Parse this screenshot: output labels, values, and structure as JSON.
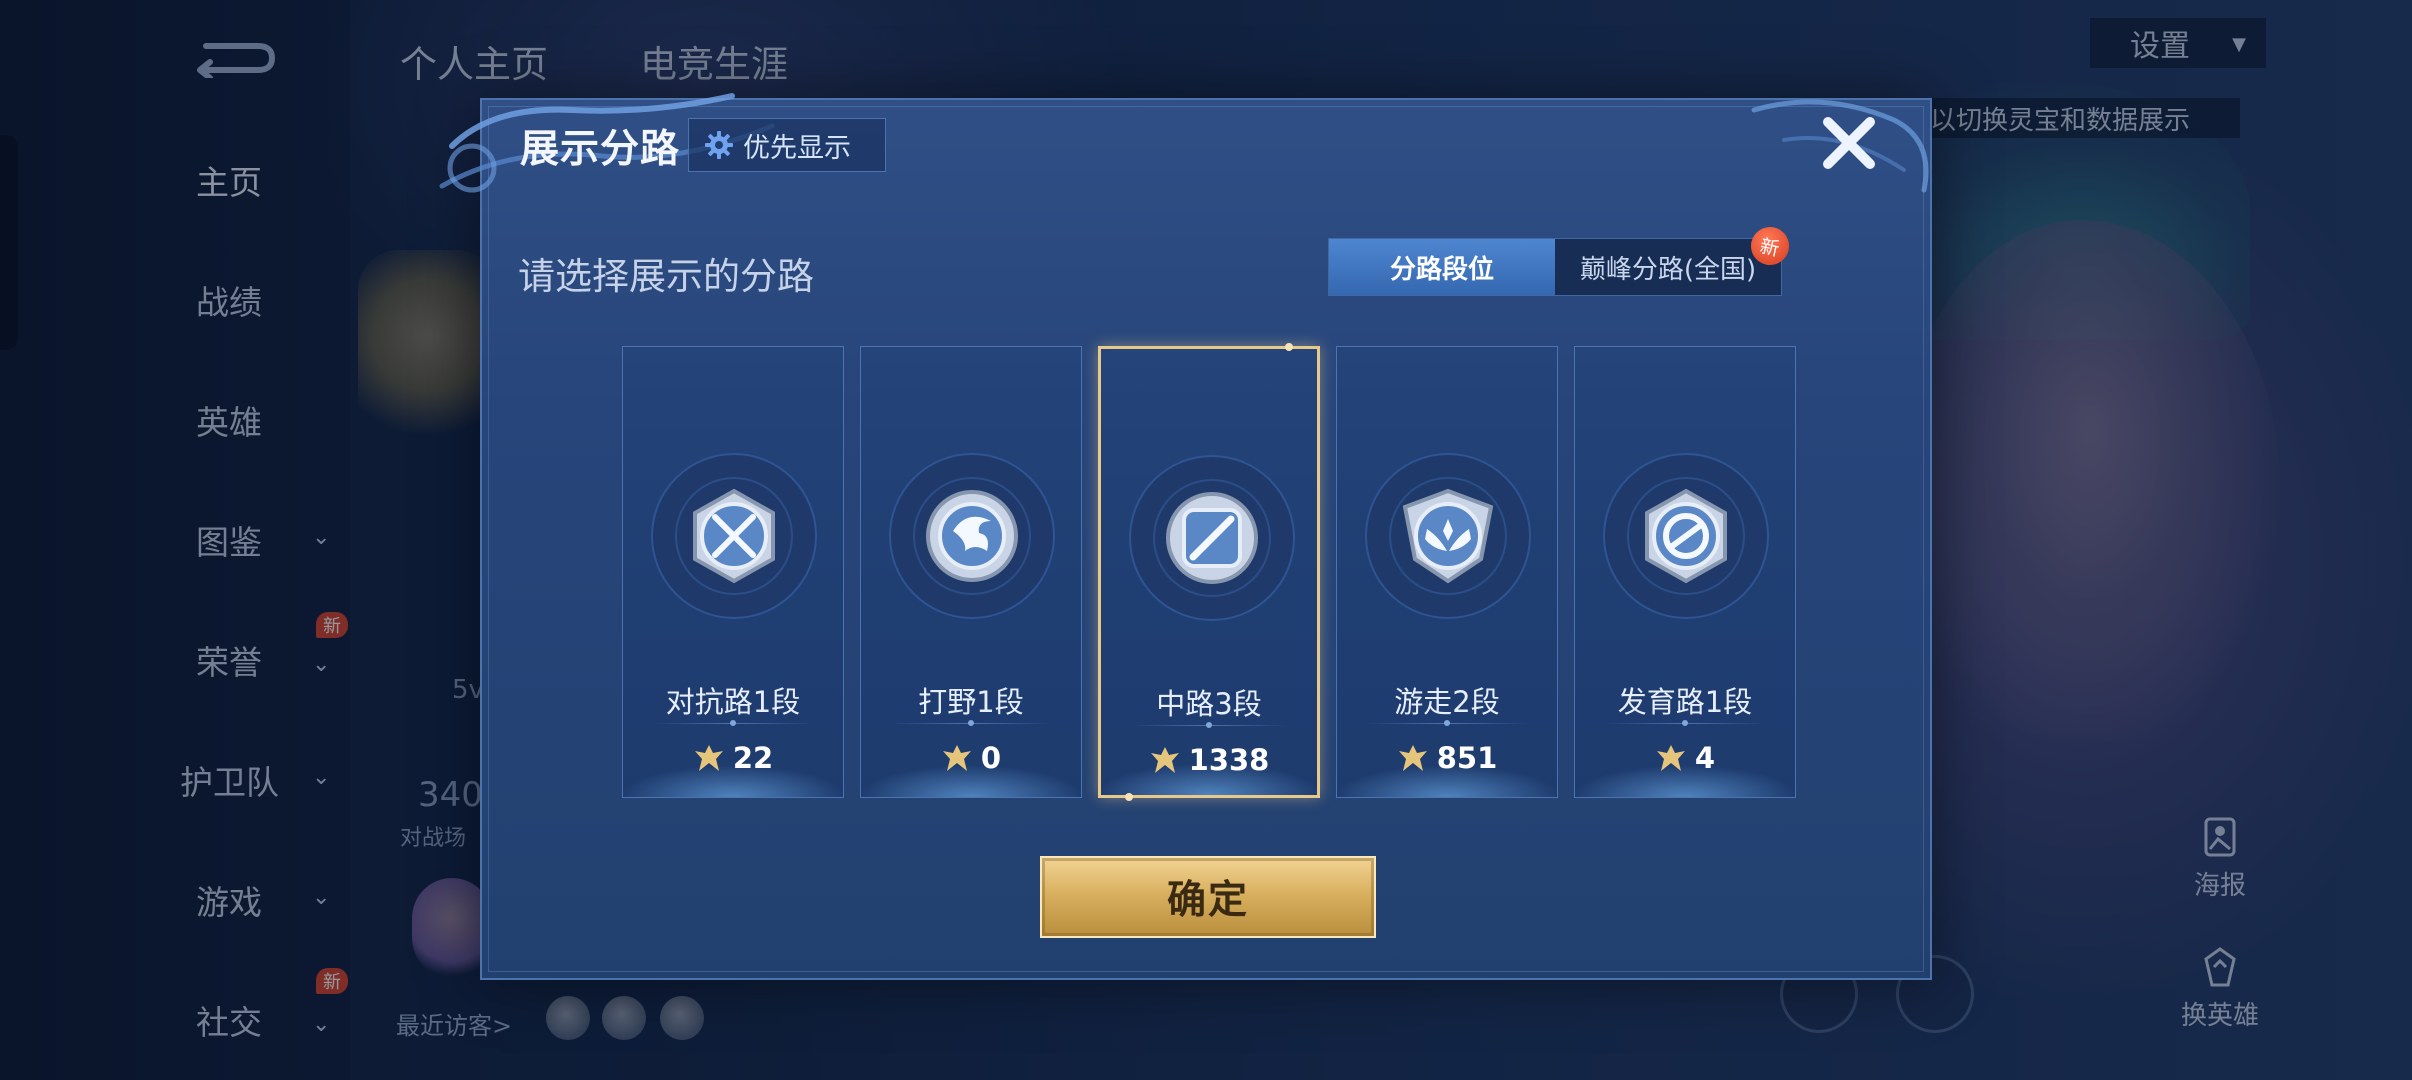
{
  "nav": {
    "items": [
      {
        "label": "主页",
        "active": true
      },
      {
        "label": "战绩"
      },
      {
        "label": "英雄"
      },
      {
        "label": "图鉴"
      },
      {
        "label": "荣誉"
      },
      {
        "label": "护卫队"
      },
      {
        "label": "游戏"
      },
      {
        "label": "社交"
      }
    ],
    "new_badge": "新"
  },
  "top_tabs": [
    "个人主页",
    "电竞生涯"
  ],
  "settings": {
    "label": "设置"
  },
  "hint": "以切换灵宝和数据展示",
  "profile": {
    "score_partial": "340",
    "score_sub_partial": "对战场",
    "mode_partial": "5v",
    "recent_visitors": "最近访客>"
  },
  "right_actions": [
    {
      "label": "海报",
      "icon": "poster-icon"
    },
    {
      "label": "换英雄",
      "icon": "switch-hero-icon"
    }
  ],
  "dialog": {
    "title": "展示分路",
    "priority_button": "优先显示",
    "subtitle": "请选择展示的分路",
    "toggle": {
      "options": [
        "分路段位",
        "巅峰分路(全国)"
      ],
      "active_index": 0,
      "new_badge": "新"
    },
    "lanes": [
      {
        "name": "对抗路1段",
        "score": "22",
        "icon": "clash-lane-icon",
        "selected": false
      },
      {
        "name": "打野1段",
        "score": "0",
        "icon": "jungle-icon",
        "selected": false
      },
      {
        "name": "中路3段",
        "score": "1338",
        "icon": "mid-lane-icon",
        "selected": true
      },
      {
        "name": "游走2段",
        "score": "851",
        "icon": "roam-icon",
        "selected": false
      },
      {
        "name": "发育路1段",
        "score": "4",
        "icon": "farm-lane-icon",
        "selected": false
      }
    ],
    "confirm": "确定"
  },
  "colors": {
    "dialog_bg": "#27457a",
    "selected_border": "#e8c98c",
    "confirm_gold": "#d9b060",
    "toggle_active": "#3f76c2"
  }
}
